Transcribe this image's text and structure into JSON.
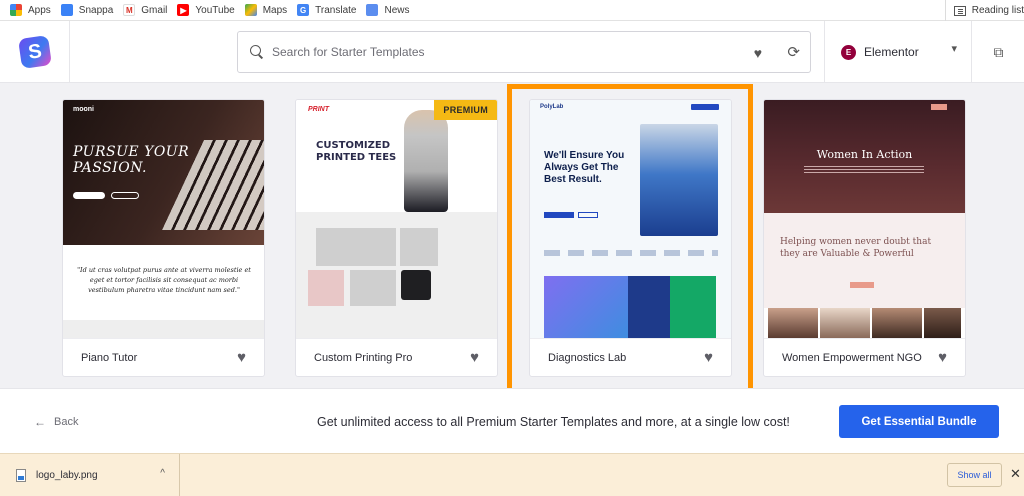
{
  "bookmarks": {
    "items": [
      {
        "label": "Apps",
        "icon": "apps-grid-icon",
        "color": "#e0443e"
      },
      {
        "label": "Snappa",
        "icon": "snappa-icon",
        "color": "#3b82f6"
      },
      {
        "label": "Gmail",
        "icon": "gmail-icon",
        "color": "#d93025"
      },
      {
        "label": "YouTube",
        "icon": "youtube-icon",
        "color": "#ff0000"
      },
      {
        "label": "Maps",
        "icon": "maps-icon",
        "color": "#34a853"
      },
      {
        "label": "Translate",
        "icon": "translate-icon",
        "color": "#4285f4"
      },
      {
        "label": "News",
        "icon": "news-icon",
        "color": "#5b8def"
      }
    ],
    "reading_list": "Reading list"
  },
  "header": {
    "logo": "S",
    "search_placeholder": "Search for Starter Templates",
    "builder": "Elementor",
    "builder_logo": "E"
  },
  "templates": [
    {
      "title": "Piano Tutor",
      "premium": false
    },
    {
      "title": "Custom Printing Pro",
      "premium": true,
      "badge": "PREMIUM"
    },
    {
      "title": "Diagnostics Lab",
      "premium": false,
      "selected": true
    },
    {
      "title": "Women Empowerment NGO",
      "premium": false
    }
  ],
  "previews": {
    "piano": {
      "brand": "mooni",
      "headline_1": "PURSUE YOUR",
      "headline_2": "PASSION.",
      "quote": "\"Id ut cras volutpat purus ante at viverra molestie et eget et tortor facilisis sit consequat ac morbi vestibulum pharetra vitae tincidunt nam sed.\""
    },
    "print": {
      "logo": "PRINT",
      "headline_1": "CUSTOMIZED",
      "headline_2": "PRINTED TEES"
    },
    "lab": {
      "logo": "PolyLab",
      "headline_1": "We'll Ensure You",
      "headline_2": "Always Get The",
      "headline_3": "Best Result."
    },
    "ngo": {
      "headline": "Women In Action",
      "sub_1": "Helping women never doubt that",
      "sub_2": "they are Valuable & Powerful"
    }
  },
  "footer": {
    "back": "Back",
    "promo": "Get unlimited access to all Premium Starter Templates and more, at a single low cost!",
    "cta": "Get Essential Bundle"
  },
  "downloads": {
    "file": "logo_laby.png",
    "show_all": "Show all"
  },
  "colors": {
    "accent": "#2563eb",
    "highlight": "#ff9400",
    "premium": "#f5b914"
  }
}
